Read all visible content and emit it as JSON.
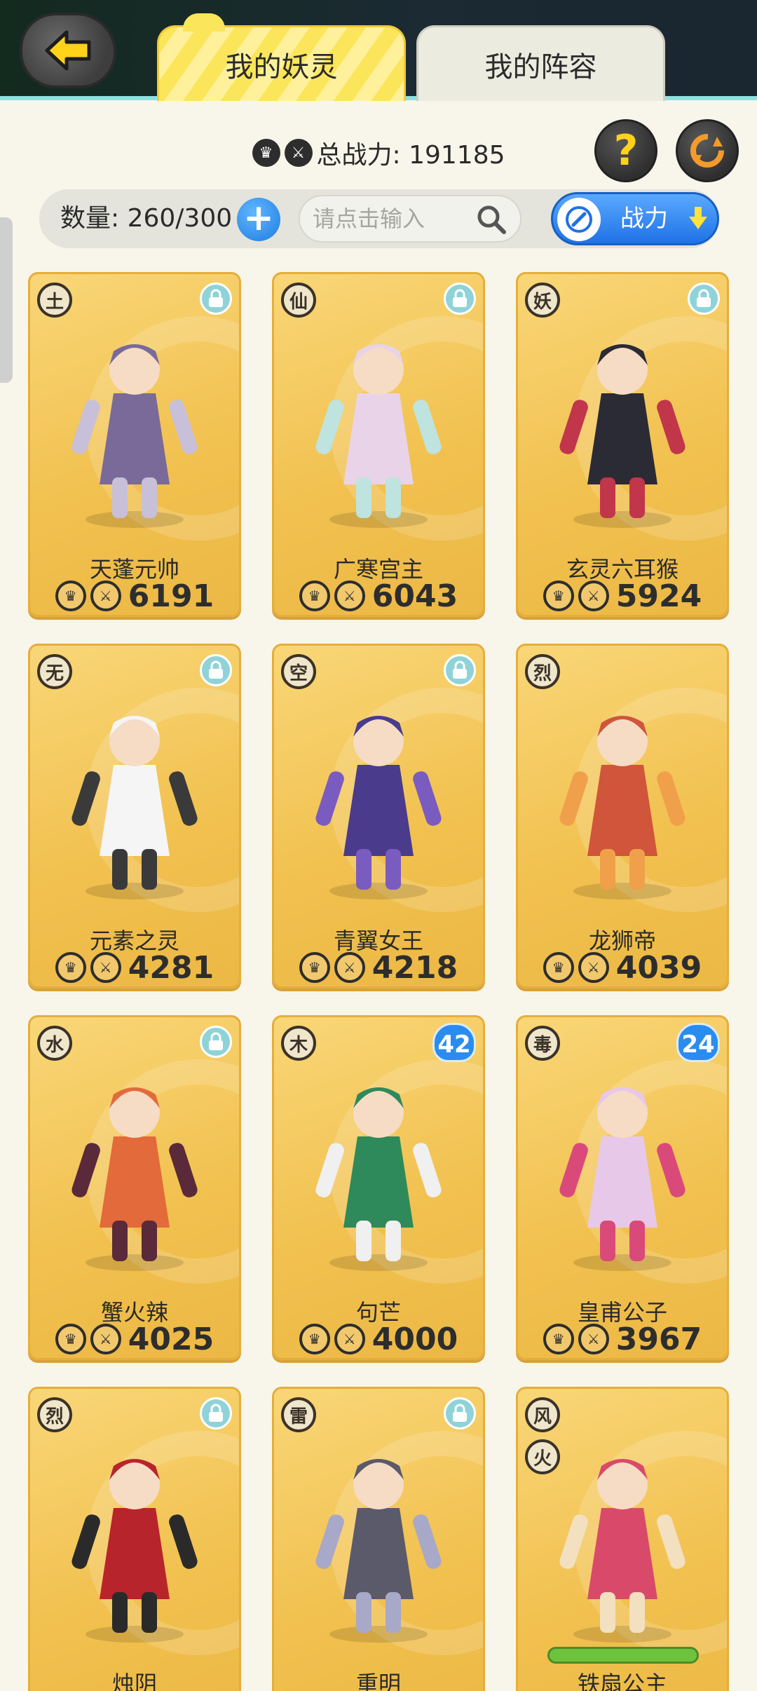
{
  "header": {
    "tabs": [
      {
        "label": "我的妖灵",
        "active": true
      },
      {
        "label": "我的阵容",
        "active": false
      }
    ]
  },
  "summary": {
    "total_power_label": "总战力: 191185"
  },
  "filter": {
    "count_label": "数量: 260/300",
    "search_placeholder": "请点击输入",
    "sort_label": "战力"
  },
  "colors": {
    "card_bg": "#f1c04e",
    "accent_blue": "#2b8cf0",
    "header_bg": "#132a1f"
  },
  "cards": [
    {
      "name": "天蓬元帅",
      "power": "6191",
      "element": [
        "土"
      ],
      "badge": "lock"
    },
    {
      "name": "广寒宫主",
      "power": "6043",
      "element": [
        "仙"
      ],
      "badge": "lock"
    },
    {
      "name": "玄灵六耳猴",
      "power": "5924",
      "element": [
        "妖"
      ],
      "badge": "lock"
    },
    {
      "name": "元素之灵",
      "power": "4281",
      "element": [
        "无"
      ],
      "badge": "lock"
    },
    {
      "name": "青翼女王",
      "power": "4218",
      "element": [
        "空"
      ],
      "badge": "lock"
    },
    {
      "name": "龙狮帝",
      "power": "4039",
      "element": [
        "烈"
      ],
      "badge": "none"
    },
    {
      "name": "蟹火辣",
      "power": "4025",
      "element": [
        "水"
      ],
      "badge": "lock"
    },
    {
      "name": "句芒",
      "power": "4000",
      "element": [
        "木"
      ],
      "badge": "level",
      "level": "42"
    },
    {
      "name": "皇甫公子",
      "power": "3967",
      "element": [
        "毒"
      ],
      "badge": "level",
      "level": "24"
    },
    {
      "name": "烛阴",
      "power": "",
      "element": [
        "烈"
      ],
      "badge": "lock"
    },
    {
      "name": "重明",
      "power": "",
      "element": [
        "雷"
      ],
      "badge": "lock"
    },
    {
      "name": "铁扇公主",
      "power": "",
      "element": [
        "风",
        "火"
      ],
      "badge": "none",
      "hp_bar": 1.0
    }
  ]
}
